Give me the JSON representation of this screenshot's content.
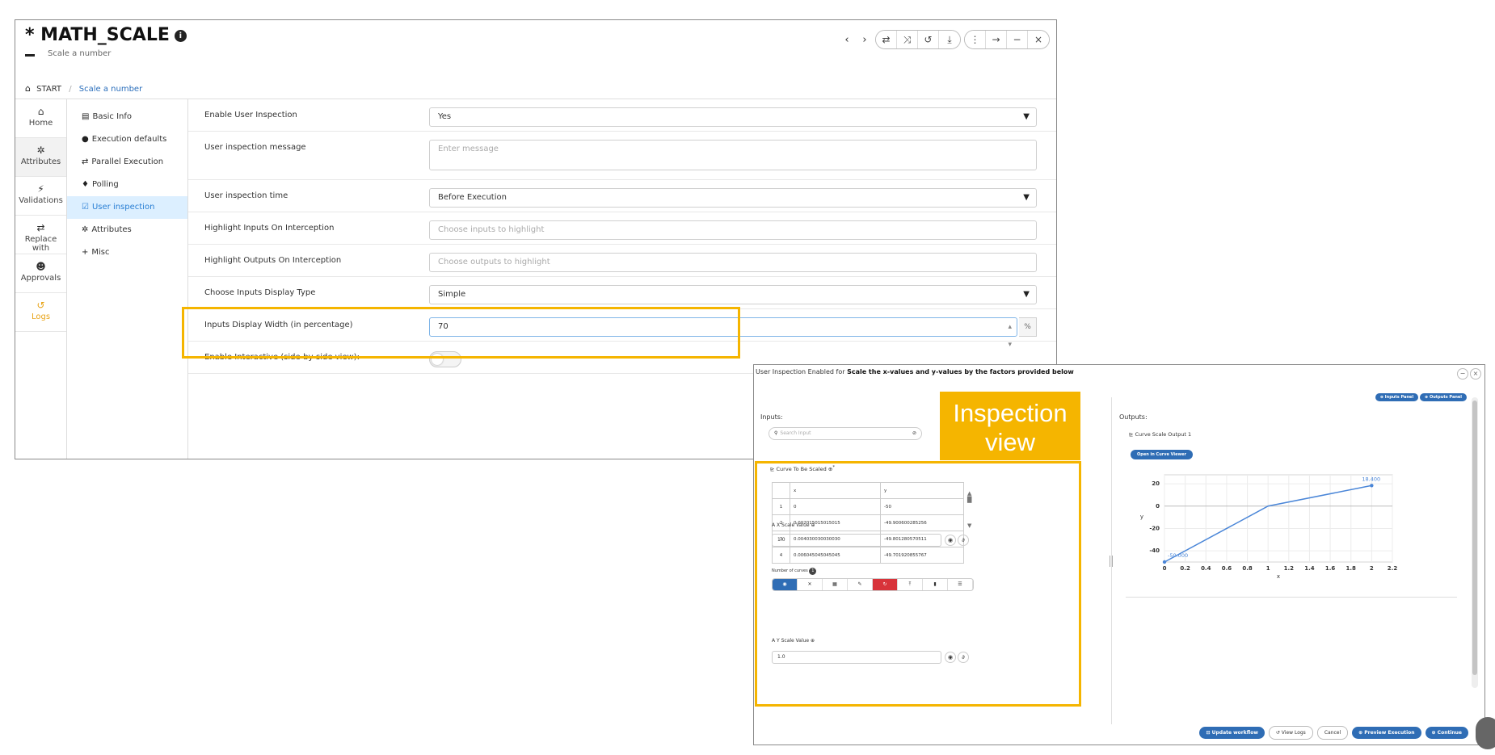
{
  "window": {
    "title": "MATH_SCALE",
    "subtitle": "Scale a number",
    "controls": {
      "back": "‹",
      "forward": "›",
      "tools": [
        "⇄",
        "⤨",
        "↺",
        "⤓"
      ],
      "menu": "⋮",
      "arrow": "→",
      "minimize": "−",
      "close": "×"
    }
  },
  "breadcrumb": {
    "root": "START",
    "separator": "/",
    "current": "Scale a number"
  },
  "rail": [
    {
      "icon": "home-icon",
      "glyph": "⌂",
      "label": "Home"
    },
    {
      "icon": "gear-icon",
      "glyph": "✲",
      "label": "Attributes"
    },
    {
      "icon": "wand-icon",
      "glyph": "⚡",
      "label": "Validations"
    },
    {
      "icon": "swap-icon",
      "glyph": "⇄",
      "label": "Replace with"
    },
    {
      "icon": "user-check-icon",
      "glyph": "☻",
      "label": "Approvals"
    },
    {
      "icon": "history-icon",
      "glyph": "↺",
      "label": "Logs"
    }
  ],
  "menu": [
    {
      "glyph": "▤",
      "label": "Basic Info"
    },
    {
      "glyph": "●",
      "label": "Execution defaults"
    },
    {
      "glyph": "⇄",
      "label": "Parallel Execution"
    },
    {
      "glyph": "♦",
      "label": "Polling"
    },
    {
      "glyph": "☑",
      "label": "User inspection"
    },
    {
      "glyph": "✲",
      "label": "Attributes"
    },
    {
      "glyph": "+",
      "label": "Misc"
    }
  ],
  "form": {
    "enable_label": "Enable User Inspection",
    "enable_value": "Yes",
    "message_label": "User inspection message",
    "message_placeholder": "Enter message",
    "time_label": "User inspection time",
    "time_value": "Before Execution",
    "hl_inputs_label": "Highlight Inputs On Interception",
    "hl_inputs_placeholder": "Choose inputs to highlight",
    "hl_outputs_label": "Highlight Outputs On Interception",
    "hl_outputs_placeholder": "Choose outputs to highlight",
    "display_type_label": "Choose Inputs Display Type",
    "display_type_value": "Simple",
    "width_label": "Inputs Display Width (in percentage)",
    "width_value": "70",
    "width_unit": "%",
    "interactive_label": "Enable Interactive (side-by-side view):"
  },
  "dialog": {
    "title_prefix": "User Inspection Enabled for ",
    "title_bold": "Scale the x-values and y-values by the factors provided below",
    "panel_buttons": [
      "⊕ Inputs Panel",
      "⊕ Outputs Panel"
    ],
    "inputs_label": "Inputs:",
    "search_placeholder": "Search Input",
    "curve_label": "Curve To Be Scaled",
    "table": {
      "headers": [
        "",
        "x",
        "y"
      ],
      "rows": [
        [
          "1",
          "0",
          "-50"
        ],
        [
          "2",
          "0.002015015015015",
          "-49.900600285256"
        ],
        [
          "3",
          "0.004030030030030",
          "-49.801280570511"
        ],
        [
          "4",
          "0.006045045045045",
          "-49.701920855767"
        ]
      ]
    },
    "number_of_curves": "Number of curves",
    "x_scale_label": "X Scale Value",
    "x_scale_value": "1.0",
    "y_scale_label": "Y Scale Value",
    "y_scale_value": "1.0",
    "outputs_label": "Outputs:",
    "output_item": "Curve Scale Output 1",
    "open_curve_viewer": "Open in Curve Viewer",
    "footer_buttons": [
      "⊡ Update workflow",
      "↺ View Logs",
      "Cancel",
      "⊕ Preview Execution",
      "⊕ Continue"
    ]
  },
  "annotation": {
    "tag": "Inspection view"
  },
  "chart_data": {
    "type": "line",
    "x": [
      0,
      1,
      2
    ],
    "y": [
      -50,
      0,
      18.4
    ],
    "xlabel": "x",
    "ylabel": "y",
    "xlim": [
      0,
      2.2
    ],
    "ylim": [
      -50,
      28
    ],
    "xticks": [
      0,
      0.2,
      0.4,
      0.6,
      0.8,
      1,
      1.2,
      1.4,
      1.6,
      1.8,
      2,
      2.2
    ],
    "yticks": [
      -40,
      -20,
      0,
      20
    ],
    "annotations": [
      "18.400",
      "-50.000"
    ],
    "color": "#4a86d8",
    "grid": true
  }
}
